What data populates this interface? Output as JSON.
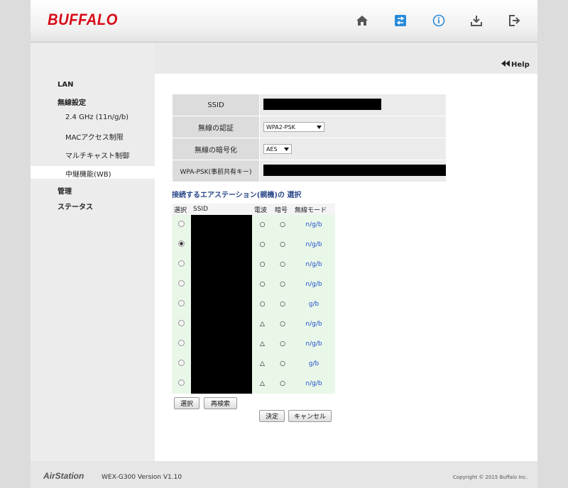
{
  "brand": {
    "logo": "BUFFALO",
    "color": "#d80c18"
  },
  "header_icons": [
    "home-icon",
    "network-icon",
    "info-icon",
    "download-icon",
    "logout-icon"
  ],
  "help": {
    "label": "Help"
  },
  "sidebar": {
    "items": [
      {
        "label": "LAN"
      },
      {
        "label": "無線設定"
      },
      {
        "label": "2.4 GHz (11n/g/b)"
      },
      {
        "label": "MACアクセス制限"
      },
      {
        "label": "マルチキャスト制御"
      },
      {
        "label": "中継機能(WB)"
      },
      {
        "label": "管理"
      },
      {
        "label": "ステータス"
      }
    ]
  },
  "form": {
    "ssid_label": "SSID",
    "auth_label": "無線の認証",
    "auth_value": "WPA2-PSK",
    "enc_label": "無線の暗号化",
    "enc_value": "AES",
    "psk_label": "WPA-PSK(事前共有キー)"
  },
  "ap_section": {
    "title": "接続するエアステーション(親機)の 選択",
    "headers": {
      "select": "選択",
      "ssid": "SSID",
      "signal": "電波",
      "security": "暗号",
      "mode": "無線モード"
    },
    "rows": [
      {
        "selected": false,
        "signal": "○",
        "security": "○",
        "mode": "n/g/b"
      },
      {
        "selected": true,
        "signal": "○",
        "security": "○",
        "mode": "n/g/b"
      },
      {
        "selected": false,
        "signal": "○",
        "security": "○",
        "mode": "n/g/b"
      },
      {
        "selected": false,
        "signal": "○",
        "security": "○",
        "mode": "n/g/b"
      },
      {
        "selected": false,
        "signal": "○",
        "security": "○",
        "mode": "g/b"
      },
      {
        "selected": false,
        "signal": "△",
        "security": "○",
        "mode": "n/g/b"
      },
      {
        "selected": false,
        "signal": "△",
        "security": "○",
        "mode": "n/g/b"
      },
      {
        "selected": false,
        "signal": "△",
        "security": "○",
        "mode": "g/b"
      },
      {
        "selected": false,
        "signal": "△",
        "security": "○",
        "mode": "n/g/b"
      }
    ]
  },
  "buttons": {
    "select": "選択",
    "rescan": "再検索",
    "apply": "決定",
    "cancel": "キャンセル"
  },
  "footer": {
    "logo": "AirStation",
    "model": "WEX-G300   Version V1.10",
    "copyright": "Copyright © 2015 Buffalo Inc."
  }
}
